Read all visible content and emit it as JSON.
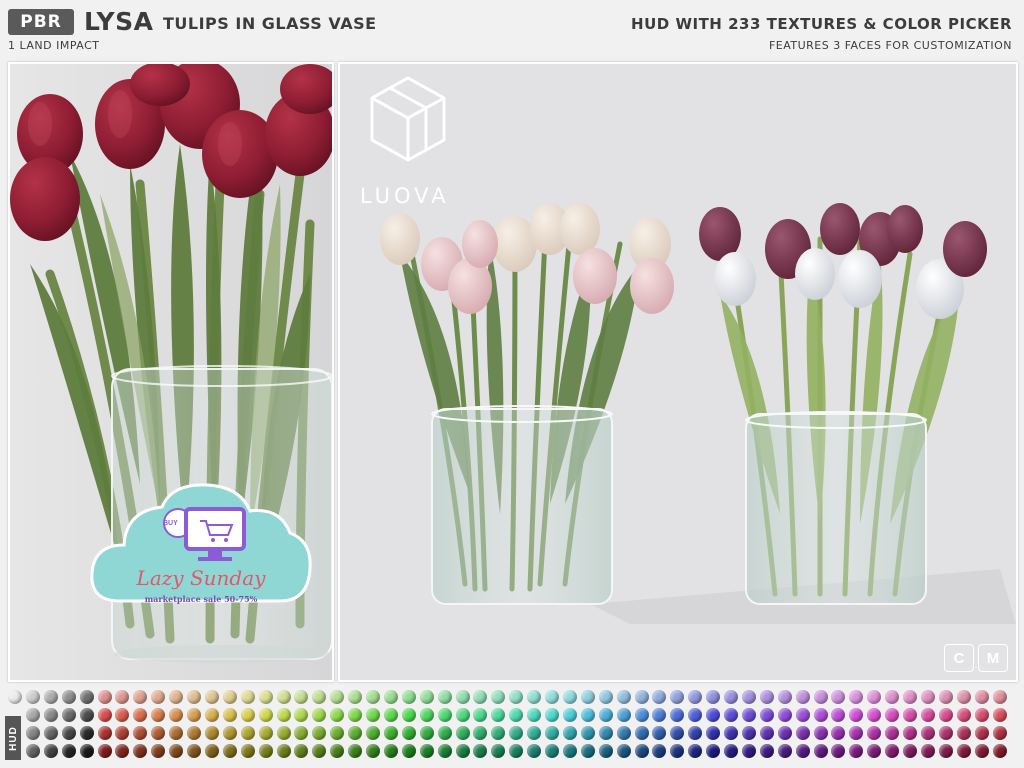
{
  "header": {
    "badge": "PBR",
    "title": "LYSA",
    "subtitle": "TULIPS IN GLASS VASE",
    "land_impact": "1 LAND IMPACT",
    "hud_title": "HUD WITH 233 TEXTURES & COLOR PICKER",
    "features": "FEATURES 3 FACES FOR CUSTOMIZATION"
  },
  "brand": {
    "logo_text": "LUOVA"
  },
  "promo": {
    "buy_label": "BUY",
    "title": "Lazy Sunday",
    "subtitle": "marketplace sale 50-75%"
  },
  "controls": {
    "c_button": "C",
    "m_button": "M"
  },
  "hud": {
    "label": "HUD",
    "columns": 56,
    "rows": 4
  },
  "colors": {
    "panel_bg": "#e2e2e4",
    "tulip_dark_red": "#8e1d33",
    "tulip_blush": "#e8c4c6",
    "tulip_plum": "#7a3a52",
    "tulip_white": "#f1f1f4",
    "stem_green": "#6f8a4a",
    "promo_cloud": "#8fd7d4",
    "promo_text": "#e2586a"
  }
}
